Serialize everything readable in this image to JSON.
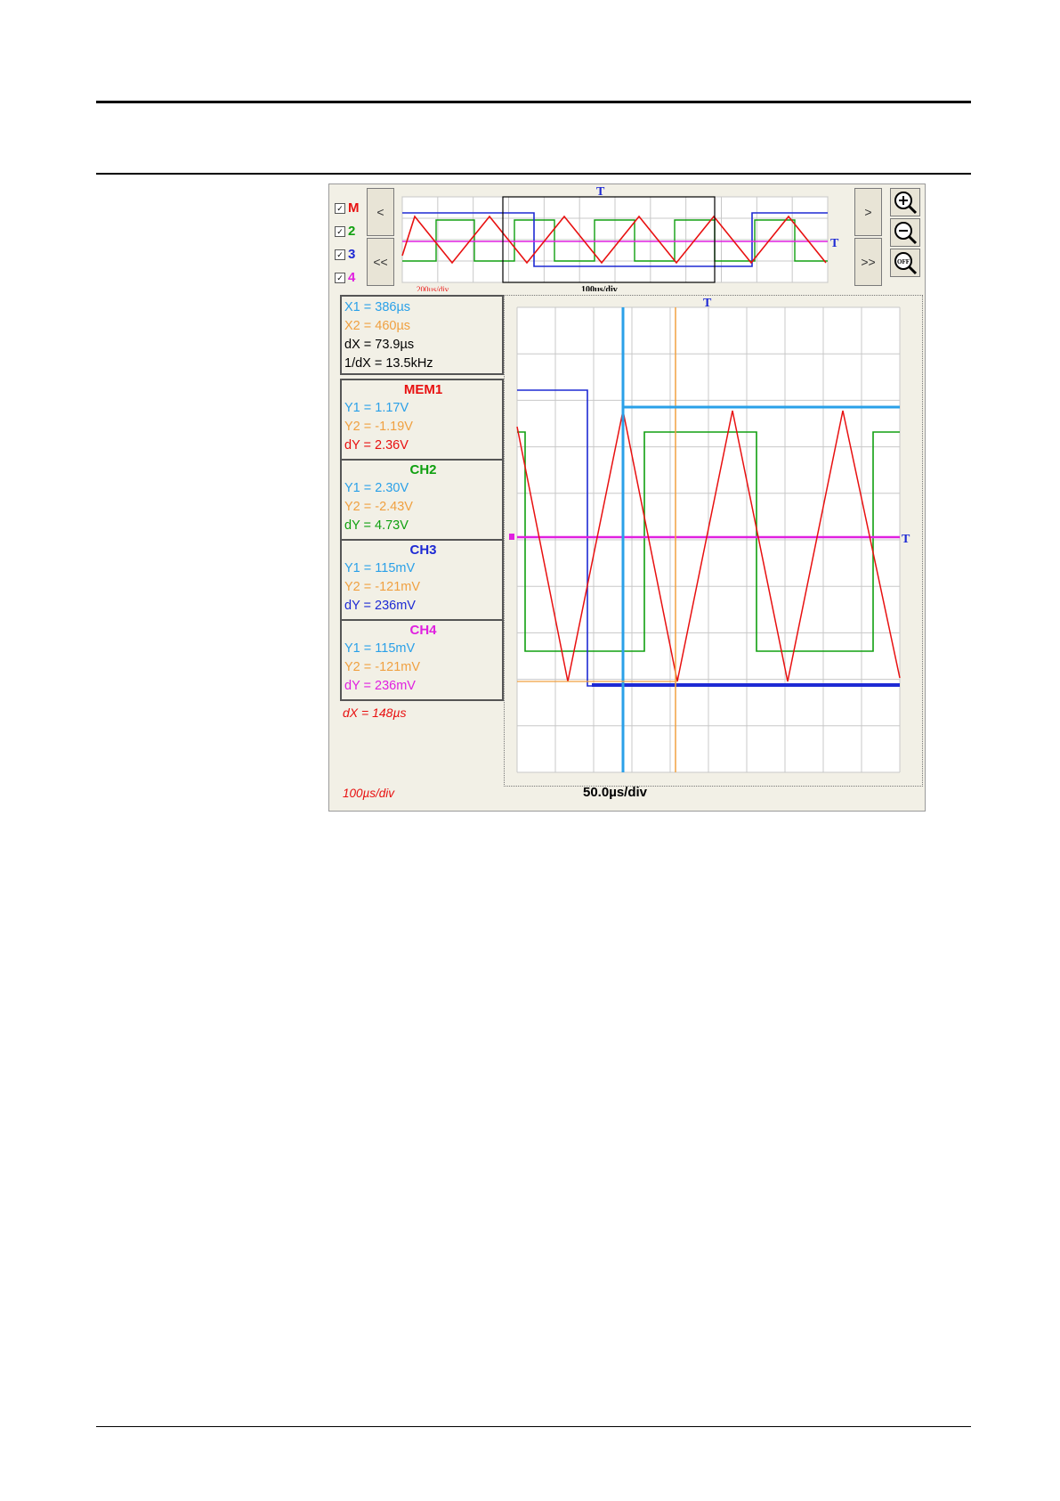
{
  "channels": [
    {
      "label": "M",
      "color": "#e81010",
      "checked": true
    },
    {
      "label": "2",
      "color": "#10a010",
      "checked": true
    },
    {
      "label": "3",
      "color": "#1e2ad4",
      "checked": true
    },
    {
      "label": "4",
      "color": "#e020e0",
      "checked": true
    }
  ],
  "nav": {
    "left": "<",
    "left_fast": "<<",
    "right": ">",
    "right_fast": ">>"
  },
  "zoom": {
    "in": "zoom-in-icon",
    "out": "zoom-out-icon",
    "off": "zoom-off-icon",
    "off_text": "OFF"
  },
  "overview": {
    "timebase_left": "200µs/div",
    "timebase_window": "100µs/div",
    "trigger": "T"
  },
  "cursor_x": {
    "x1": "X1 = 386µs",
    "x2": "X2 = 460µs",
    "dx": "dX = 73.9µs",
    "inv": "1/dX = 13.5kHz"
  },
  "readouts": [
    {
      "title": "MEM1",
      "color": "#e81010",
      "y1": "Y1 = 1.17V",
      "y2": "Y2 = -1.19V",
      "dy": "dY = 2.36V"
    },
    {
      "title": "CH2",
      "color": "#10a010",
      "y1": "Y1 = 2.30V",
      "y2": "Y2 = -2.43V",
      "dy": "dY = 4.73V"
    },
    {
      "title": "CH3",
      "color": "#1e2ad4",
      "y1": "Y1 = 115mV",
      "y2": "Y2 = -121mV",
      "dy": "dY = 236mV"
    },
    {
      "title": "CH4",
      "color": "#e020e0",
      "y1": "Y1 = 115mV",
      "y2": "Y2 = -121mV",
      "dy": "dY = 236mV"
    }
  ],
  "mem_dx": "dX = 148µs",
  "mem_timebase": "100µs/div",
  "main_timebase": "50.0µs/div",
  "trigger_label": "T",
  "colors": {
    "cursor1": "#2aa0e8",
    "cursor2": "#f0a040",
    "grid": "#c8c8c8",
    "background": "#f2f0e6"
  }
}
